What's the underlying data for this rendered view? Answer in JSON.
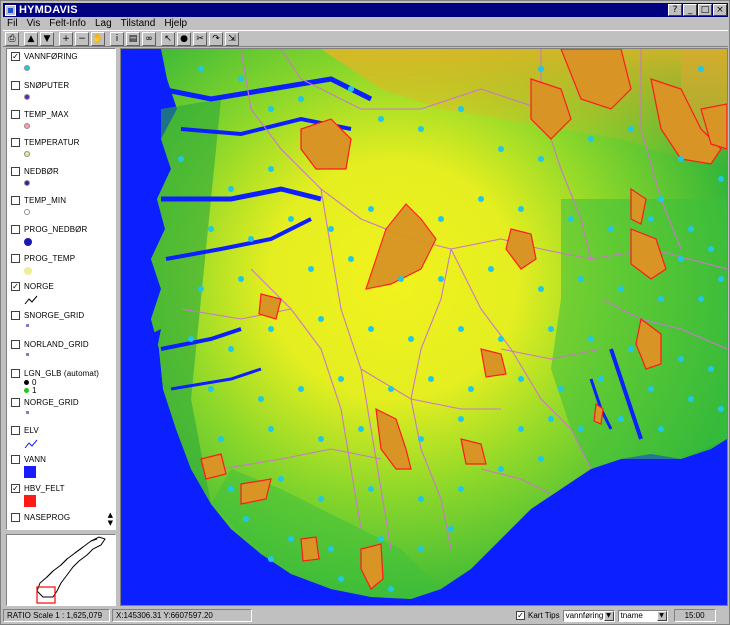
{
  "window": {
    "title": "HYMDAVIS"
  },
  "titlebar_buttons": {
    "help": "?",
    "minimize": "_",
    "maximize": "□",
    "close": "×"
  },
  "menu": [
    "Fil",
    "Vis",
    "Felt-Info",
    "Lag",
    "Tilstand",
    "Hjelp"
  ],
  "toolbar": {
    "tools": [
      {
        "icon": "print-icon",
        "glyph": "⎙"
      },
      {
        "icon": "layer-up-icon",
        "glyph": "▲"
      },
      {
        "icon": "layer-down-icon",
        "glyph": "▼"
      },
      {
        "icon": "zoom-in-icon",
        "glyph": "+"
      },
      {
        "icon": "zoom-out-icon",
        "glyph": "−"
      },
      {
        "icon": "pan-hand-icon",
        "glyph": "✋"
      },
      {
        "icon": "info-icon",
        "glyph": "i"
      },
      {
        "icon": "table-icon",
        "glyph": "▤"
      },
      {
        "icon": "binoculars-icon",
        "glyph": "∞"
      },
      {
        "icon": "select-arrow-icon",
        "glyph": "↖"
      },
      {
        "icon": "dot-icon",
        "glyph": "●"
      },
      {
        "icon": "cut-icon",
        "glyph": "✂"
      },
      {
        "icon": "arrow-curve-icon",
        "glyph": "↷"
      },
      {
        "icon": "export-icon",
        "glyph": "⇲"
      }
    ]
  },
  "legend": {
    "layers": [
      {
        "name": "VANNFØRING",
        "checked": true,
        "symbol": "dot",
        "color": "#1ec8e6"
      },
      {
        "name": "SNØPUTER",
        "checked": false,
        "symbol": "dot",
        "color": "#5a2bb5"
      },
      {
        "name": "TEMP_MAX",
        "checked": false,
        "symbol": "dot",
        "color": "#ff9aa8"
      },
      {
        "name": "TEMPERATUR",
        "checked": false,
        "symbol": "dot",
        "color": "#e8e88a"
      },
      {
        "name": "NEDBØR",
        "checked": false,
        "symbol": "dot",
        "color": "#3a22a0"
      },
      {
        "name": "TEMP_MIN",
        "checked": false,
        "symbol": "dot",
        "color": "#ffffff"
      },
      {
        "name": "PROG_NEDBØR",
        "checked": false,
        "symbol": "bigdot",
        "color": "#1a1ab0"
      },
      {
        "name": "PROG_TEMP",
        "checked": false,
        "symbol": "bigdot",
        "color": "#eded9a"
      },
      {
        "name": "NORGE",
        "checked": true,
        "symbol": "line",
        "color": "#000000"
      },
      {
        "name": "SNORGE_GRID",
        "checked": false,
        "symbol": "small",
        "color": "#8080c0"
      },
      {
        "name": "NORLAND_GRID",
        "checked": false,
        "symbol": "small",
        "color": "#8080c0"
      },
      {
        "name": "LGN_GLB (automat)",
        "checked": false,
        "symbol": "pair",
        "color": "#000000",
        "items": [
          "0",
          "1"
        ]
      },
      {
        "name": "NORGE_GRID",
        "checked": false,
        "symbol": "small",
        "color": "#8080c0"
      },
      {
        "name": "ELV",
        "checked": false,
        "symbol": "line",
        "color": "#1a1aff"
      },
      {
        "name": "VANN",
        "checked": false,
        "symbol": "square",
        "color": "#1a1aff"
      },
      {
        "name": "HBV_FELT",
        "checked": true,
        "symbol": "square",
        "color": "#ff1a1a"
      },
      {
        "name": "NASEPROG",
        "checked": false,
        "symbol": "none",
        "color": "#000000"
      }
    ],
    "scroll_up": "▲",
    "scroll_down": "▼"
  },
  "status": {
    "ratio": "RATIO Scale 1 : 1,625,079",
    "coords": "X:145306.31 Y:6607597.20",
    "kart_tips_label": "Kart Tips",
    "kart_tips_checked": true,
    "layer_select": "vannføring",
    "field_select": "tname",
    "time": "15:00"
  },
  "colors": {
    "sea": "#0b1fff",
    "lowland": "#3cc03c",
    "highland": "#e8e820",
    "mountain": "#d8a020",
    "catchment": "#ff1a1a",
    "borders": "#c878c8",
    "stations": "#1ec8e6"
  }
}
